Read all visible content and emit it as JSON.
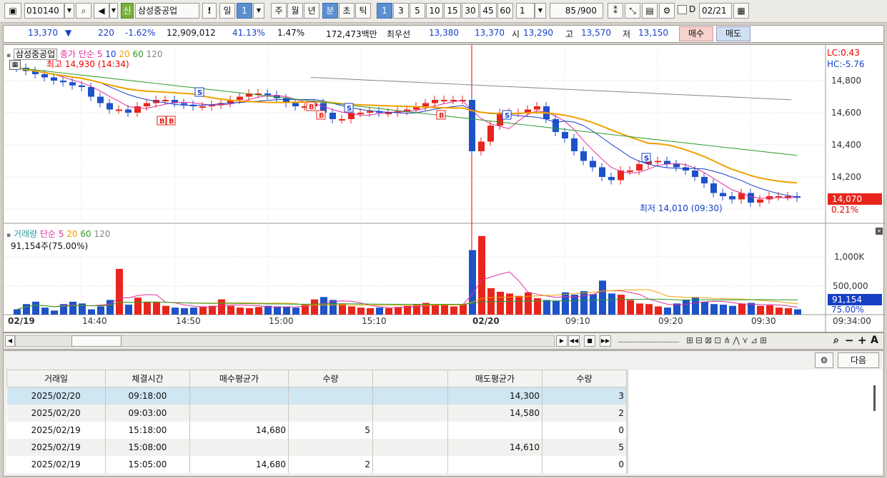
{
  "toolbar": {
    "stock_code": "010140",
    "stock_badge": "신",
    "stock_name": "삼성중공업",
    "periods": [
      "일",
      "1",
      "주",
      "월",
      "년",
      "분",
      "초",
      "틱"
    ],
    "minute_buttons": [
      "1",
      "3",
      "5",
      "10",
      "15",
      "30",
      "45",
      "60"
    ],
    "interval_value": "1",
    "count_value": "85",
    "count_total": "/900",
    "date_label": "D",
    "date_value": "02/21"
  },
  "quote": {
    "price": "13,370",
    "change_sign": "▼",
    "change": "220",
    "change_pct": "-1.62%",
    "volume": "12,909,012",
    "turnover_rate": "41.13%",
    "ratio": "1.47%",
    "trade_value": "172,473백만",
    "best_label": "최우선",
    "best_ask": "13,380",
    "best_bid": "13,370",
    "open_label": "시",
    "open": "13,290",
    "high_label": "고",
    "high": "13,570",
    "low_label": "저",
    "low": "13,150",
    "buy_label": "매수",
    "sell_label": "매도"
  },
  "price_chart": {
    "title": "삼성중공업",
    "ma_label": "종가 단순",
    "ma_periods": [
      "5",
      "10",
      "20",
      "60",
      "120"
    ],
    "ma_colors": [
      "#e0309a",
      "#1740c8",
      "#f0a000",
      "#2a9a2a",
      "#888888"
    ],
    "max_annotation": "최고 14,930 (14:34)",
    "min_annotation": "최저 14,010 (09:30)",
    "lc": "LC:0.43",
    "hc": "HC:-5.76",
    "y_ticks": [
      "14,800",
      "14,600",
      "14,400",
      "14,200"
    ],
    "current_price": "14,070",
    "current_pct": "0.21%"
  },
  "volume_chart": {
    "title": "거래량",
    "ma_label": "단순",
    "ma_periods": [
      "5",
      "20",
      "60",
      "120"
    ],
    "ma_colors": [
      "#e0309a",
      "#f0a000",
      "#2a9a2a",
      "#888888"
    ],
    "summary": "91,154주(75.00%)",
    "y_ticks": [
      "1,000K",
      "500,000"
    ],
    "current_volume": "91,154",
    "current_pct": "75.00%"
  },
  "x_axis": {
    "labels": [
      "02/19",
      "14:40",
      "14:50",
      "15:00",
      "15:10",
      "02/20",
      "09:10",
      "09:20",
      "09:30",
      "09:34:00"
    ]
  },
  "lower_panel": {
    "next_label": "다음",
    "columns": [
      "거래일",
      "체결시간",
      "매수평균가",
      "수량",
      "",
      "매도평균가",
      "수량"
    ],
    "rows": [
      [
        "2025/02/20",
        "09:18:00",
        "",
        "",
        "",
        "14,300",
        "3"
      ],
      [
        "2025/02/20",
        "09:03:00",
        "",
        "",
        "",
        "14,580",
        "2"
      ],
      [
        "2025/02/19",
        "15:18:00",
        "14,680",
        "5",
        "",
        "",
        "0"
      ],
      [
        "2025/02/19",
        "15:08:00",
        "",
        "",
        "",
        "14,610",
        "5"
      ],
      [
        "2025/02/19",
        "15:05:00",
        "14,680",
        "2",
        "",
        "",
        "0"
      ]
    ]
  }
}
